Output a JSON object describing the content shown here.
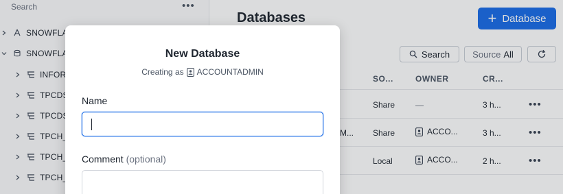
{
  "sidebar": {
    "search_label": "Search",
    "more_label": "•••",
    "items": [
      {
        "label": "SNOWFLAKE"
      },
      {
        "label": "SNOWFLAKE_SAMPLE_DATA"
      },
      {
        "label": "INFORMATION_SCHEMA"
      },
      {
        "label": "TPCDS_SF100TCL"
      },
      {
        "label": "TPCDS_SF10TCL"
      },
      {
        "label": "TPCH_SF1"
      },
      {
        "label": "TPCH_SF10"
      },
      {
        "label": "TPCH_SF100"
      }
    ]
  },
  "main": {
    "title": "Databases",
    "add_button_label": "Database",
    "add_button_plus": "+",
    "toolbar": {
      "search_label": "Search",
      "source_label": "Source",
      "source_value": "All",
      "refresh_icon": "refresh-icon"
    },
    "columns": [
      "SO...",
      "OWNER",
      "CR..."
    ],
    "rows": [
      {
        "name": "",
        "source": "Share",
        "owner": "—",
        "created": "3 h..."
      },
      {
        "name": "M...",
        "source": "Share",
        "owner": "ACCO...",
        "created": "3 h..."
      },
      {
        "name": "",
        "source": "Local",
        "owner": "ACCO...",
        "created": "2 h..."
      }
    ],
    "row_menu_label": "•••"
  },
  "modal": {
    "title": "New Database",
    "subtitle_prefix": "Creating as",
    "role": "ACCOUNTADMIN",
    "name_label": "Name",
    "name_value": "",
    "comment_label": "Comment",
    "comment_optional": "(optional)",
    "comment_value": ""
  },
  "colors": {
    "accent": "#1a6ce7",
    "text": "#1e252f",
    "muted": "#6b7280"
  }
}
